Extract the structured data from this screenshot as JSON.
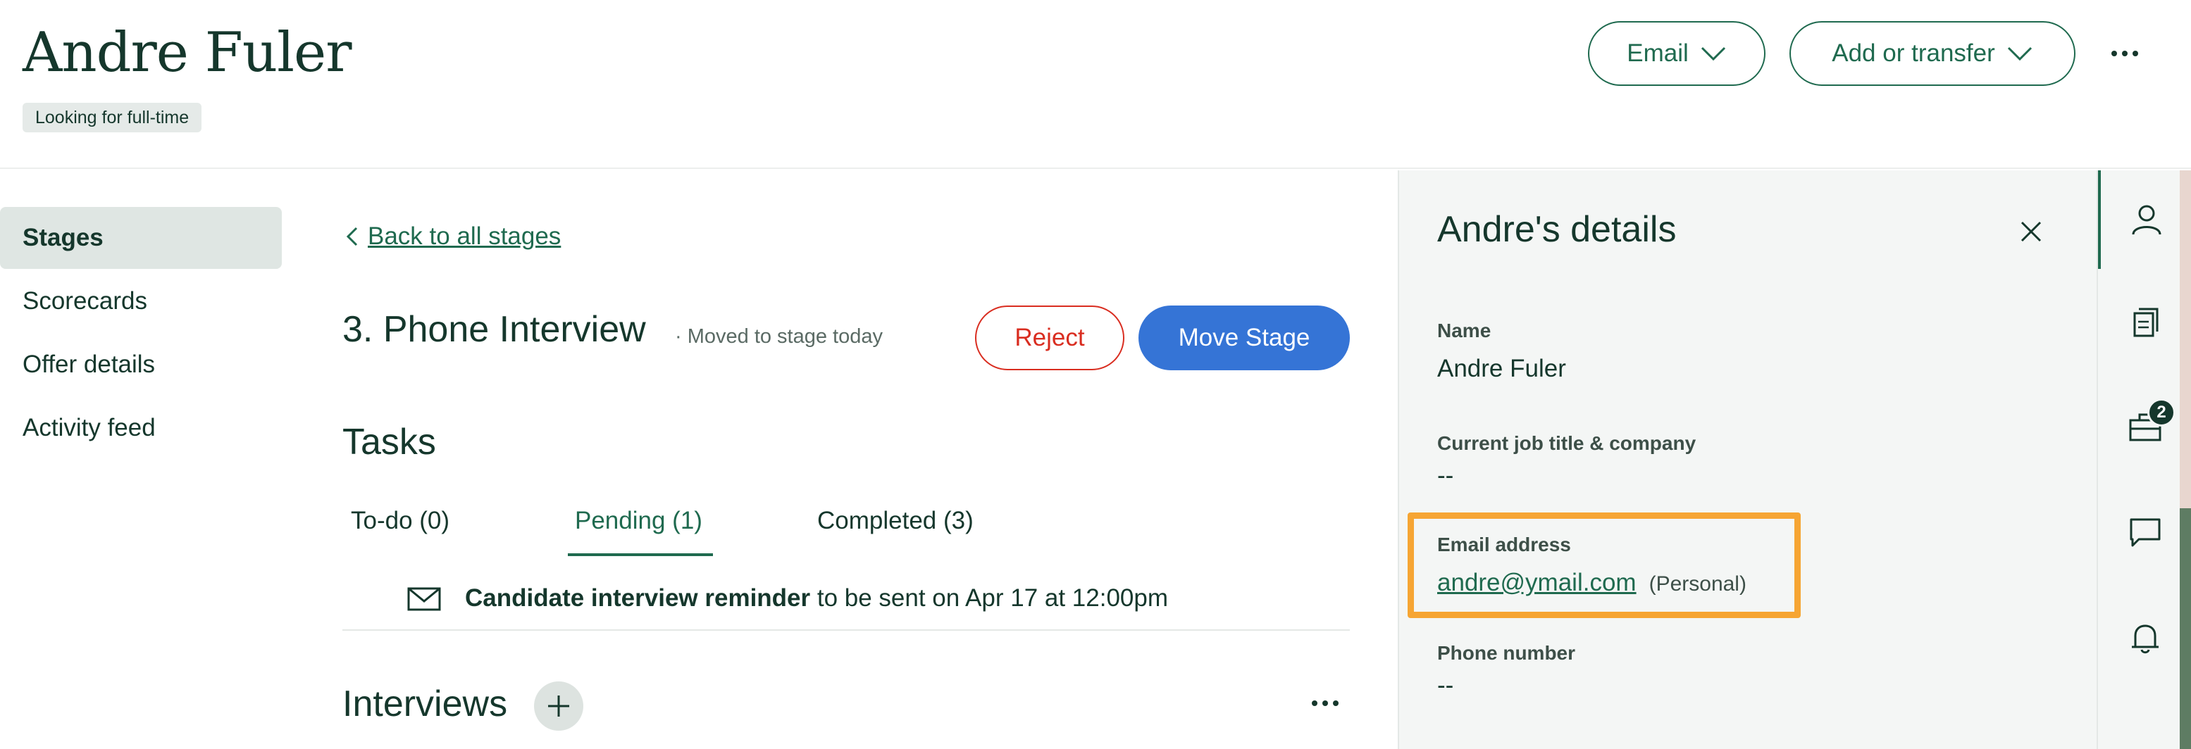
{
  "header": {
    "candidate_name": "Andre Fuler",
    "tag": "Looking for full-time",
    "email_button": "Email",
    "add_transfer_button": "Add or transfer"
  },
  "nav": {
    "items": [
      {
        "label": "Stages",
        "active": true
      },
      {
        "label": "Scorecards",
        "active": false
      },
      {
        "label": "Offer details",
        "active": false
      },
      {
        "label": "Activity feed",
        "active": false
      }
    ]
  },
  "main": {
    "back_link": "Back to all stages",
    "stage_title": "3. Phone Interview",
    "stage_meta": "·  Moved to stage today",
    "reject_button": "Reject",
    "move_stage_button": "Move Stage",
    "tasks_title": "Tasks",
    "tabs": [
      {
        "label": "To-do (0)",
        "active": false
      },
      {
        "label": "Pending (1)",
        "active": true
      },
      {
        "label": "Completed (3)",
        "active": false
      }
    ],
    "task": {
      "bold_text": "Candidate interview reminder",
      "rest_text": " to be sent on Apr 17 at 12:00pm"
    },
    "interviews_title": "Interviews"
  },
  "details": {
    "title": "Andre's details",
    "fields": [
      {
        "label": "Name",
        "value": "Andre Fuler"
      },
      {
        "label": "Current job title & company",
        "value": "--"
      },
      {
        "label": "Email address",
        "value": "andre@ymail.com",
        "qualifier": "(Personal)"
      },
      {
        "label": "Phone number",
        "value": "--"
      }
    ]
  },
  "rail": {
    "items": [
      {
        "icon": "person-icon",
        "active": true
      },
      {
        "icon": "documents-icon",
        "active": false
      },
      {
        "icon": "briefcase-icon",
        "active": false,
        "badge": "2"
      },
      {
        "icon": "chat-icon",
        "active": false
      },
      {
        "icon": "bell-icon",
        "active": false
      }
    ]
  },
  "colors": {
    "brand_green": "#1f6a4f",
    "text_dark": "#15372c",
    "reject_red": "#d92d20",
    "primary_blue": "#3574d6",
    "highlight_orange": "#f6a533",
    "panel_bg": "#f4f6f5"
  }
}
